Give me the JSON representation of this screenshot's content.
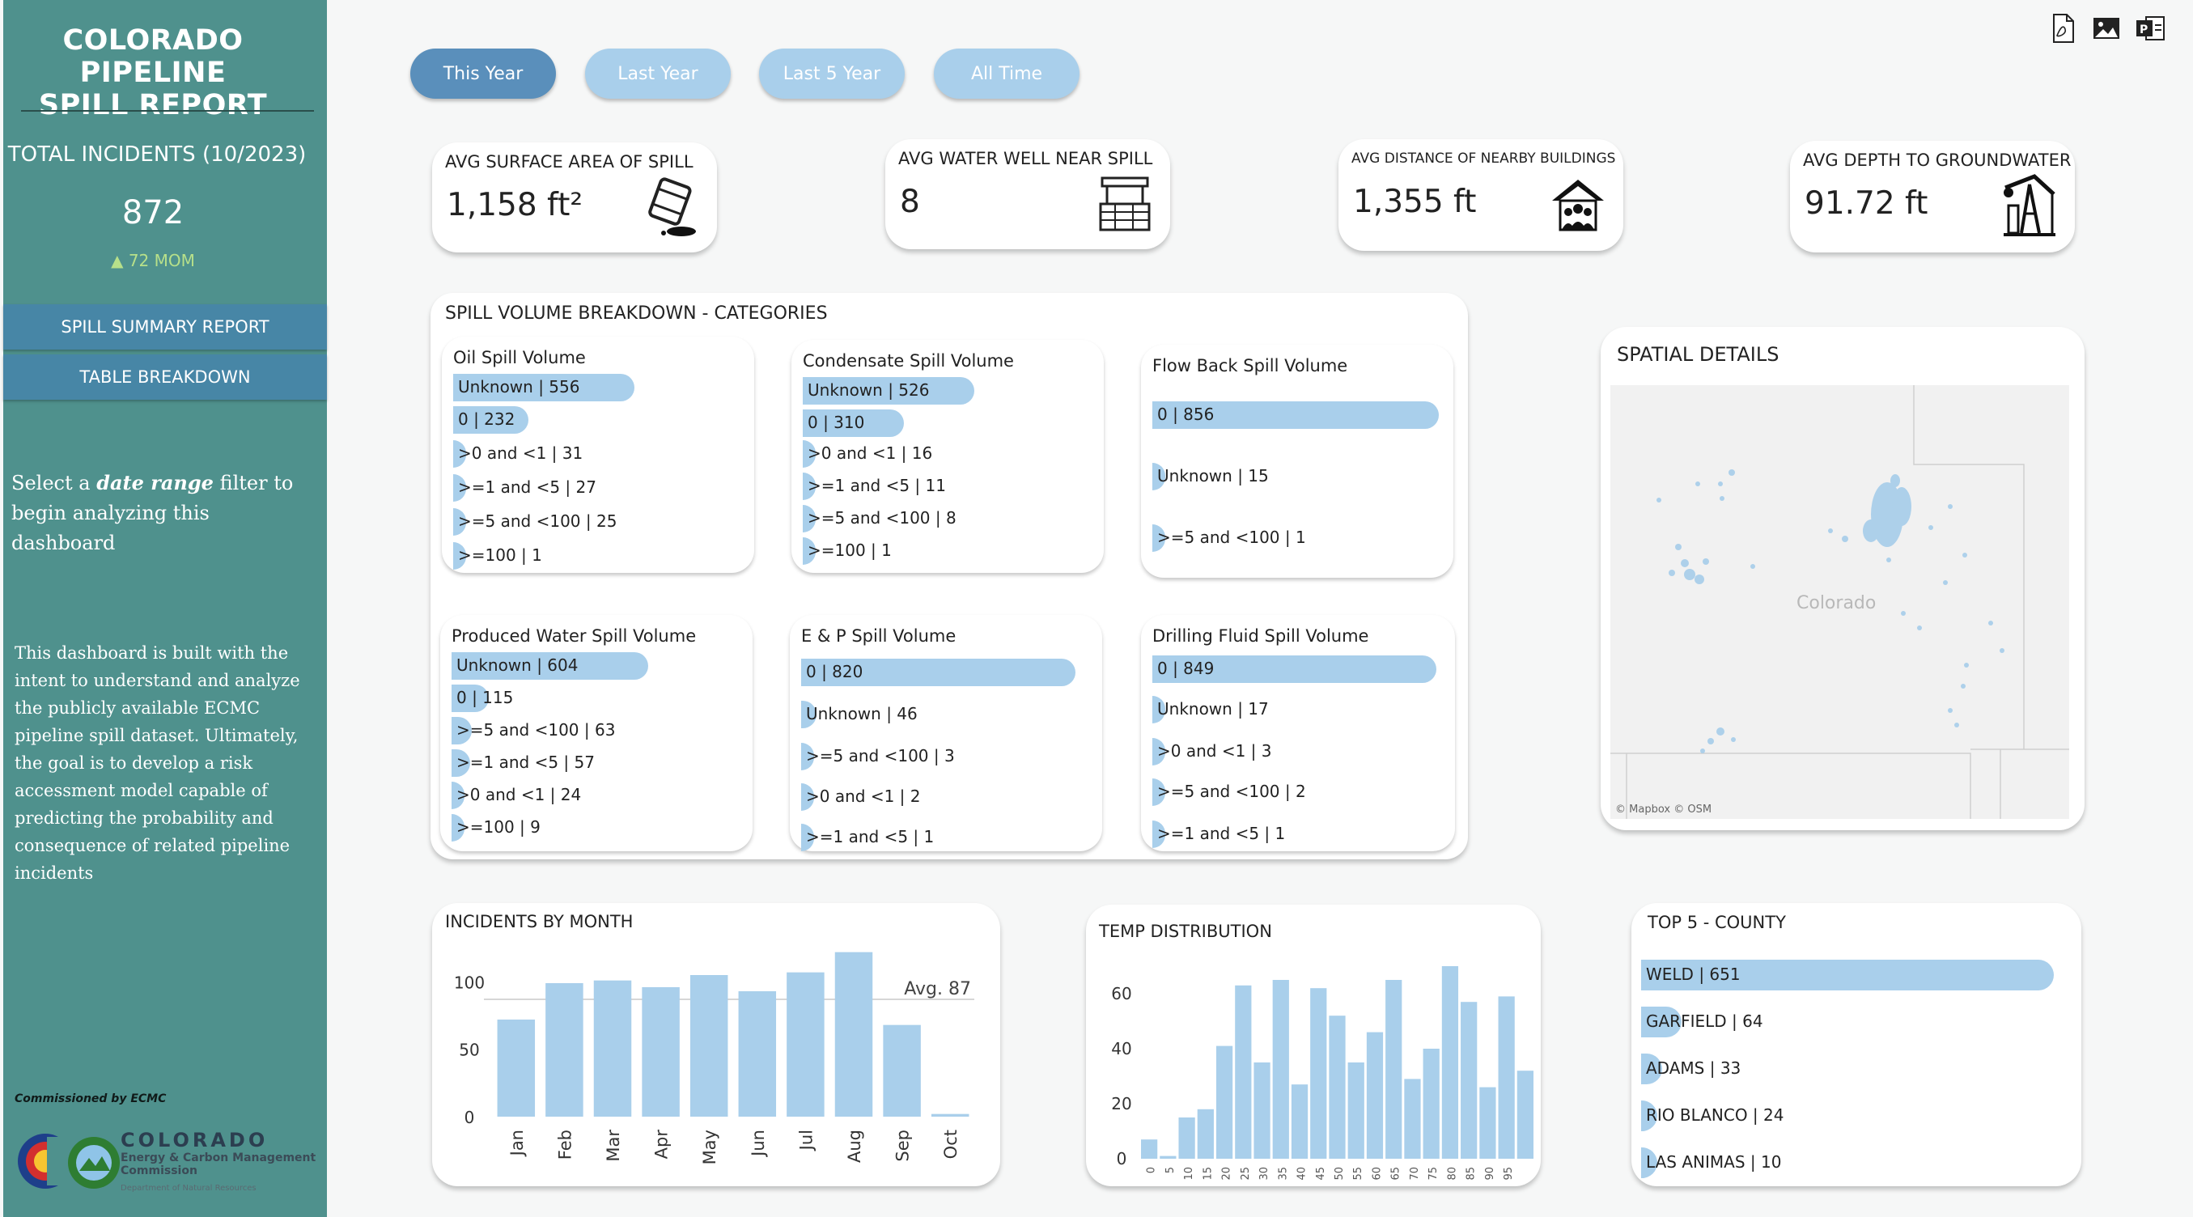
{
  "sidebar": {
    "title_line1": "COLORADO PIPELINE",
    "title_line2": "SPILL REPORT",
    "total_label": "TOTAL INCIDENTS  (10/2023)",
    "total_value": "872",
    "mom": "▲ 72 MOM",
    "mom_color": "#b7e08a",
    "nav": [
      "SPILL SUMMARY REPORT",
      "TABLE BREAKDOWN"
    ],
    "prompt_pre": "Select a ",
    "prompt_em": "date range",
    "prompt_post": " filter to begin analyzing this dashboard",
    "description": "This dashboard is built with the intent to understand and analyze the publicly available ECMC pipeline spill dataset. Ultimately, the goal is to develop a risk accessment model capable of predicting the probability and consequence of related pipeline incidents",
    "commissioned": "Commissioned by ECMC",
    "logo": {
      "l1": "COLORADO",
      "l2a": "Energy & Carbon Management",
      "l2b": "Commission",
      "l3": "Department of Natural Resources"
    }
  },
  "filters": [
    "This Year",
    "Last Year",
    "Last 5 Year",
    "All Time"
  ],
  "active_filter": "This Year",
  "toolbar_icons": [
    "pdf-export-icon",
    "image-export-icon",
    "powerpoint-export-icon"
  ],
  "kpis": [
    {
      "label": "AVG SURFACE AREA OF SPILL",
      "value": "1,158 ft²",
      "icon": "oil-barrel-icon"
    },
    {
      "label": "AVG WATER WELL NEAR SPILL",
      "value": "8",
      "icon": "water-well-icon"
    },
    {
      "label": "AVG DISTANCE OF NEARBY BUILDINGS",
      "value": "1,355 ft",
      "icon": "house-people-icon"
    },
    {
      "label": "AVG DEPTH TO GROUNDWATER",
      "value": "91.72 ft",
      "icon": "pumpjack-icon"
    }
  ],
  "breakdown": {
    "title": "SPILL VOLUME BREAKDOWN - CATEGORIES",
    "max": 870,
    "groups": [
      {
        "title": "Oil Spill Volume",
        "items": [
          {
            "label": "Unknown | 556",
            "value": 556
          },
          {
            "label": "0 | 232",
            "value": 232
          },
          {
            "label": ">0 and <1 | 31",
            "value": 31
          },
          {
            "label": ">=1 and <5 | 27",
            "value": 27
          },
          {
            "label": ">=5 and <100 | 25",
            "value": 25
          },
          {
            "label": ">=100 | 1",
            "value": 1
          }
        ]
      },
      {
        "title": "Condensate Spill Volume",
        "items": [
          {
            "label": "Unknown | 526",
            "value": 526
          },
          {
            "label": "0 | 310",
            "value": 310
          },
          {
            "label": ">0 and <1 | 16",
            "value": 16
          },
          {
            "label": ">=1 and <5 | 11",
            "value": 11
          },
          {
            "label": ">=5 and <100 | 8",
            "value": 8
          },
          {
            "label": ">=100 | 1",
            "value": 1
          }
        ]
      },
      {
        "title": "Flow Back Spill Volume",
        "items": [
          {
            "label": "0 | 856",
            "value": 856
          },
          {
            "label": "Unknown | 15",
            "value": 15
          },
          {
            "label": ">=5 and <100 | 1",
            "value": 1
          }
        ]
      },
      {
        "title": "Produced Water Spill Volume",
        "items": [
          {
            "label": "Unknown | 604",
            "value": 604
          },
          {
            "label": "0 | 115",
            "value": 115
          },
          {
            "label": ">=5 and <100 | 63",
            "value": 63
          },
          {
            "label": ">=1 and <5 | 57",
            "value": 57
          },
          {
            "label": ">0 and <1 | 24",
            "value": 24
          },
          {
            "label": ">=100 | 9",
            "value": 9
          }
        ]
      },
      {
        "title": "E & P Spill Volume",
        "items": [
          {
            "label": "0 | 820",
            "value": 820
          },
          {
            "label": "Unknown | 46",
            "value": 46
          },
          {
            "label": ">=5 and <100 | 3",
            "value": 3
          },
          {
            "label": ">0 and <1 | 2",
            "value": 2
          },
          {
            "label": ">=1 and <5 | 1",
            "value": 1
          }
        ]
      },
      {
        "title": "Drilling Fluid Spill Volume",
        "items": [
          {
            "label": "0 | 849",
            "value": 849
          },
          {
            "label": "Unknown | 17",
            "value": 17
          },
          {
            "label": ">0 and <1 | 3",
            "value": 3
          },
          {
            "label": ">=5 and <100 | 2",
            "value": 2
          },
          {
            "label": ">=1 and <5 | 1",
            "value": 1
          }
        ]
      }
    ]
  },
  "map": {
    "title": "SPATIAL DETAILS",
    "state_label": "Colorado",
    "attribution": "© Mapbox © OSM"
  },
  "chart_data": [
    {
      "type": "bar",
      "title": "INCIDENTS BY MONTH",
      "categories": [
        "Jan",
        "Feb",
        "Mar",
        "Apr",
        "May",
        "Jun",
        "Jul",
        "Aug",
        "Sep",
        "Oct"
      ],
      "values": [
        72,
        99,
        101,
        96,
        105,
        93,
        107,
        122,
        68,
        2
      ],
      "ylim": [
        0,
        120
      ],
      "yticks": [
        0,
        50,
        100
      ],
      "reference_line": {
        "value": 87,
        "label": "Avg. 87"
      },
      "grid": false,
      "color": "#a9cfeb"
    },
    {
      "type": "bar",
      "title": "TEMP DISTRIBUTION",
      "categories": [
        "0",
        "5",
        "10",
        "15",
        "20",
        "25",
        "30",
        "35",
        "40",
        "45",
        "50",
        "55",
        "60",
        "65",
        "70",
        "75",
        "80",
        "85",
        "90",
        "95"
      ],
      "values": [
        7,
        1,
        15,
        18,
        41,
        63,
        35,
        65,
        27,
        62,
        52,
        35,
        46,
        65,
        29,
        40,
        70,
        57,
        26,
        59,
        32
      ],
      "x_values": [
        0,
        5,
        10,
        15,
        20,
        25,
        30,
        35,
        40,
        45,
        50,
        55,
        60,
        65,
        70,
        75,
        80,
        85,
        90,
        95,
        100
      ],
      "ylim": [
        0,
        70
      ],
      "yticks": [
        0,
        20,
        40,
        60
      ],
      "grid": false,
      "color": "#a9cfeb"
    },
    {
      "type": "bar",
      "title": "TOP 5 - COUNTY",
      "categories": [
        "WELD | 651",
        "GARFIELD | 64",
        "ADAMS | 33",
        "RIO BLANCO | 24",
        "LAS ANIMAS | 10"
      ],
      "values": [
        651,
        64,
        33,
        24,
        10
      ],
      "orientation": "horizontal",
      "color": "#a9cfeb"
    }
  ]
}
